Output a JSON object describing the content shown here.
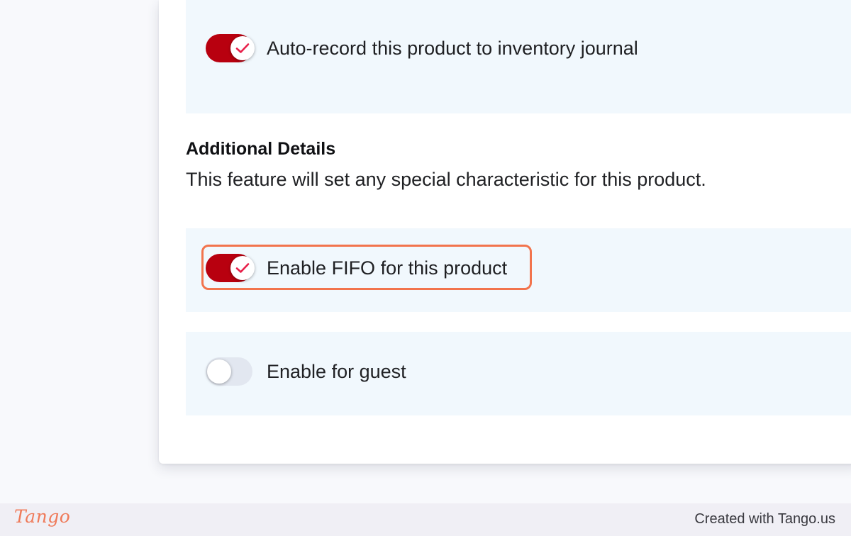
{
  "settings": {
    "auto_record": {
      "label": "Auto-record this product to inventory journal",
      "enabled": true
    },
    "additional_details": {
      "title": "Additional Details",
      "description": "This feature will set any special characteristic for this product."
    },
    "fifo": {
      "label": "Enable FIFO for this product",
      "enabled": true
    },
    "guest": {
      "label": "Enable for guest",
      "enabled": false
    }
  },
  "footer": {
    "brand": "Tango",
    "credit": "Created with Tango.us"
  },
  "colors": {
    "toggle_on": "#b8000f",
    "toggle_off": "#e2e7f0",
    "check": "#e8204a",
    "highlight": "#f2744d",
    "panel_bg": "#f1f8fd",
    "brand": "#ef7a59"
  },
  "icons": {
    "toggle_check": "checkmark-icon"
  }
}
